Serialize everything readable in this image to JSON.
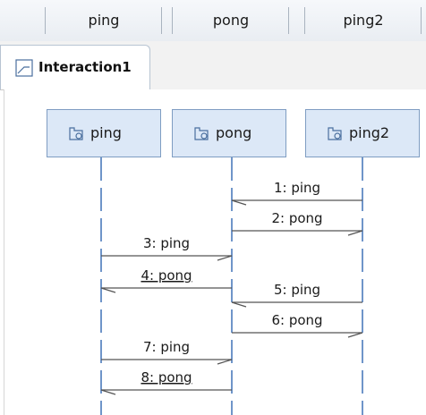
{
  "columns": [
    "ping",
    "pong",
    "ping2"
  ],
  "tab": {
    "label": "Interaction1"
  },
  "lifelines": [
    "ping",
    "pong",
    "ping2"
  ],
  "messages": [
    {
      "num": 1,
      "text": "1: ping",
      "from": "ping2",
      "to": "pong",
      "underlined": false
    },
    {
      "num": 2,
      "text": "2: pong",
      "from": "pong",
      "to": "ping2",
      "underlined": false
    },
    {
      "num": 3,
      "text": "3: ping",
      "from": "ping",
      "to": "pong",
      "underlined": false
    },
    {
      "num": 4,
      "text": "4: pong",
      "from": "pong",
      "to": "ping",
      "underlined": true
    },
    {
      "num": 5,
      "text": "5: ping",
      "from": "ping2",
      "to": "pong",
      "underlined": false
    },
    {
      "num": 6,
      "text": "6: pong",
      "from": "pong",
      "to": "ping2",
      "underlined": false
    },
    {
      "num": 7,
      "text": "7: ping",
      "from": "ping",
      "to": "pong",
      "underlined": false
    },
    {
      "num": 8,
      "text": "8: pong",
      "from": "pong",
      "to": "ping",
      "underlined": true
    }
  ],
  "colors": {
    "lifeline": "#6f95c9",
    "arrow": "#555555",
    "head_fill": "#dce8f7",
    "head_border": "#7f9dc2"
  }
}
